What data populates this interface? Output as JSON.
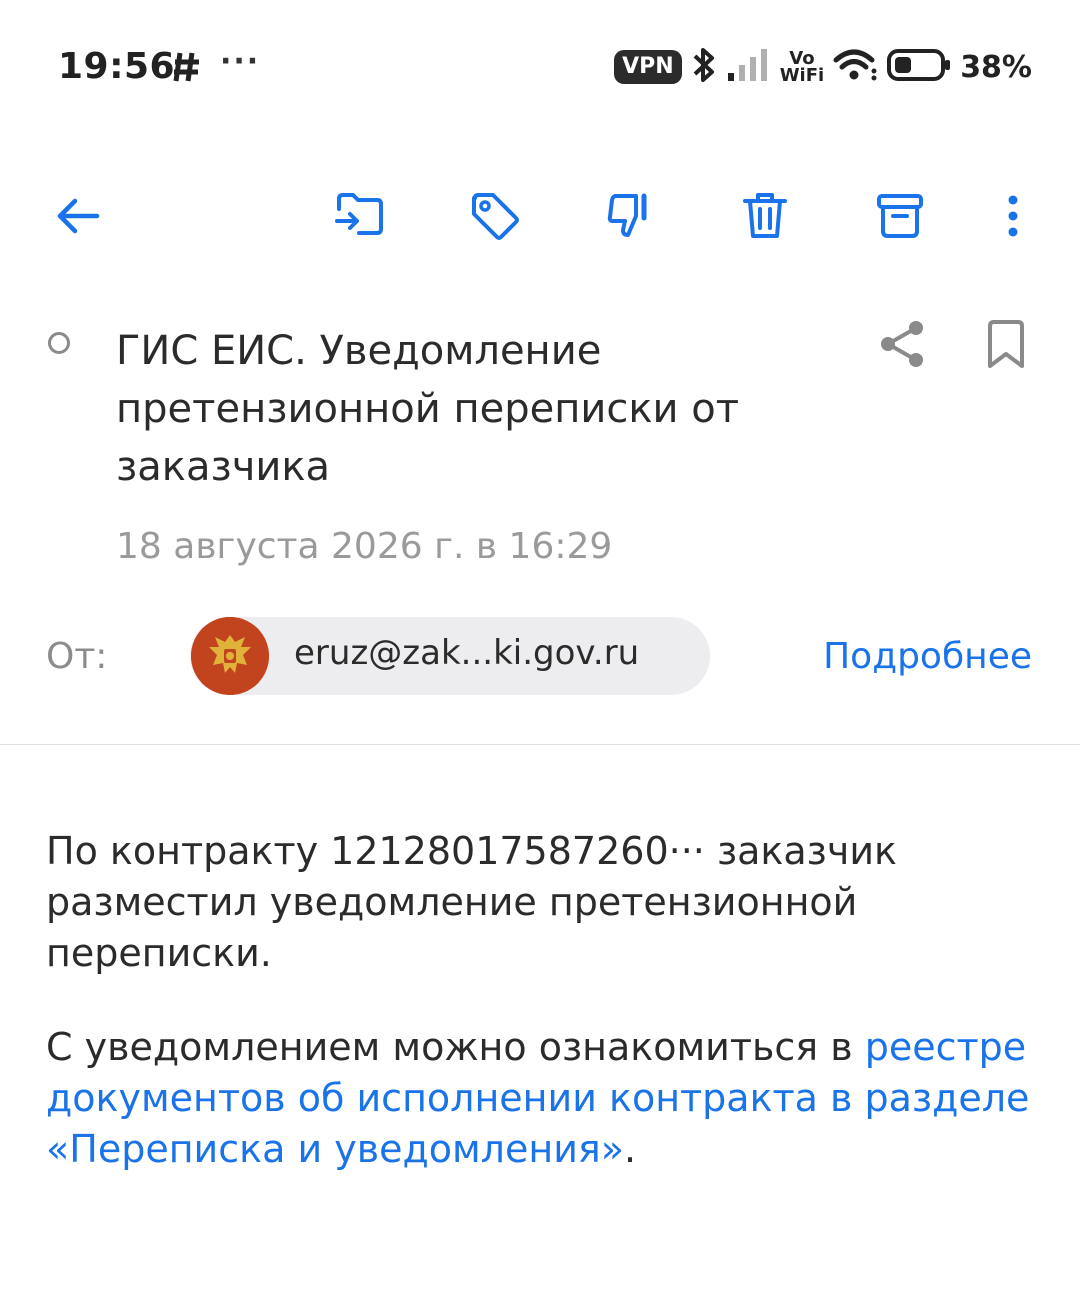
{
  "status_bar": {
    "time": "19:56",
    "dots": "···",
    "vpn": "VPN",
    "vowifi_top": "Vo",
    "vowifi_bottom": "WiFi",
    "battery_percent": "38%",
    "battery_level": 0.38
  },
  "toolbar": {
    "icons": [
      "back-arrow-icon",
      "move-icon",
      "tag-icon",
      "spam-icon",
      "trash-icon",
      "archive-icon",
      "more-vertical-icon"
    ]
  },
  "message": {
    "subject": "ГИС ЕИС. Уведомление претензионной переписки от заказчика",
    "date": "18 августа 2026 г. в 16:29",
    "from_label": "От:",
    "sender": "eruz@zak...ki.gov.ru",
    "details_link": "Подробнее",
    "para1": "По контракту 12128017587260··· заказчик разместил уведомление претензионной переписки.",
    "para2_text": "С уведомлением можно ознакомиться в ",
    "para2_link": "реестре документов об исполнении контракта в разделе «Переписка и уведомления»",
    "para2_end": "."
  },
  "colors": {
    "accent": "#1a73e8",
    "text": "#2b2b2b",
    "muted": "#9a9a9a",
    "chip_bg": "#ededf0",
    "avatar_bg": "#c2441f"
  }
}
